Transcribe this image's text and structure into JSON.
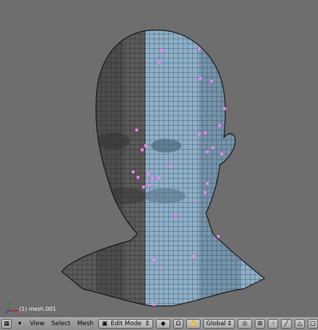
{
  "viewport": {
    "object_label": "(1) mesh.001",
    "background": "#6e6e6e",
    "mesh_colors": {
      "left_half": "#5a5a5a",
      "right_half": "#8db0c8",
      "vertex_select": "#ff7cf5"
    }
  },
  "toolbar": {
    "menus": [
      "View",
      "Select",
      "Mesh"
    ],
    "mode_label": "Edit Mode",
    "orientation_label": "Global",
    "icons": [
      "window-type-icon",
      "triangle-arrow-icon",
      "pivot-icon",
      "proportional-icon",
      "hand-icon",
      "snap-icon",
      "vertex-select-icon",
      "edge-select-icon",
      "face-select-icon"
    ]
  }
}
